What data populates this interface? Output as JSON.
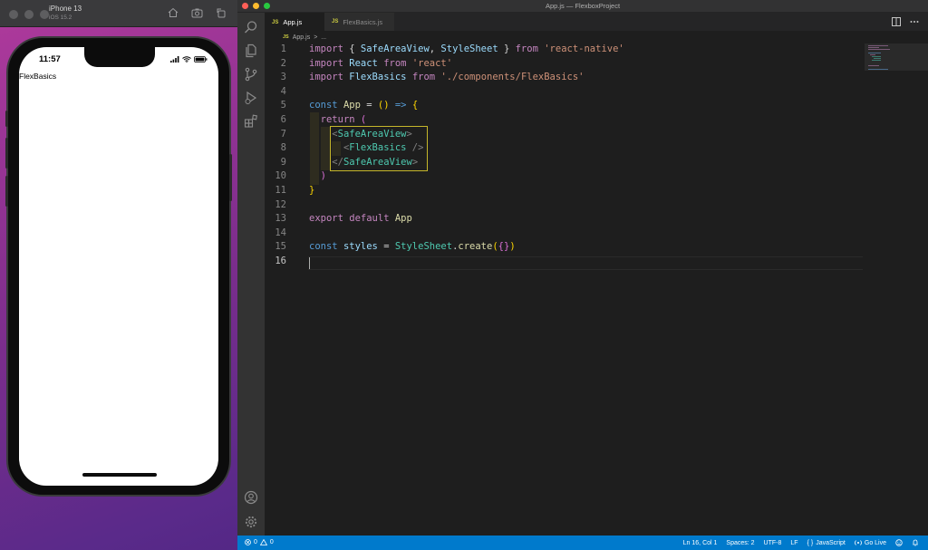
{
  "simulator": {
    "device_name": "iPhone 13",
    "os_version": "iOS 15.2",
    "status_time": "11:57",
    "app_text": "FlexBasics"
  },
  "vscode": {
    "window_title": "App.js — FlexboxProject",
    "tabs": [
      {
        "badge": "JS",
        "label": "App.js",
        "active": true
      },
      {
        "badge": "JS",
        "label": "FlexBasics.js",
        "active": false
      }
    ],
    "breadcrumb": {
      "badge": "JS",
      "file": "App.js",
      "separator": ">",
      "rest": "..."
    },
    "line_numbers": [
      "1",
      "2",
      "3",
      "4",
      "5",
      "6",
      "7",
      "8",
      "9",
      "10",
      "11",
      "12",
      "13",
      "14",
      "15",
      "16"
    ],
    "code": {
      "l1": {
        "kw": "import",
        "open": " { ",
        "a": "SafeAreaView",
        "comma": ", ",
        "b": "StyleSheet",
        "close": " } ",
        "from": "from",
        "sp": " ",
        "str": "'react-native'"
      },
      "l2": {
        "kw": "import",
        "sp": " ",
        "a": "React",
        "sp2": " ",
        "from": "from",
        "sp3": " ",
        "str": "'react'"
      },
      "l3": {
        "kw": "import",
        "sp": " ",
        "a": "FlexBasics",
        "sp2": " ",
        "from": "from",
        "sp3": " ",
        "str": "'./components/FlexBasics'"
      },
      "l5": {
        "kw": "const",
        "sp": " ",
        "name": "App",
        "eq": " = ",
        "paren": "()",
        "arrow": " => ",
        "brace": "{"
      },
      "l6": {
        "indent": "  ",
        "kw": "return",
        "sp": " ",
        "paren": "("
      },
      "l7": {
        "indent": "    ",
        "lt": "<",
        "tag": "SafeAreaView",
        "gt": ">"
      },
      "l8": {
        "indent": "      ",
        "lt": "<",
        "tag": "FlexBasics",
        "gt": " />"
      },
      "l9": {
        "indent": "    ",
        "lt": "</",
        "tag": "SafeAreaView",
        "gt": ">"
      },
      "l10": {
        "indent": "  ",
        "paren": ")"
      },
      "l11": {
        "brace": "}"
      },
      "l13": {
        "kw": "export",
        "sp": " ",
        "kw2": "default",
        "sp2": " ",
        "name": "App"
      },
      "l15": {
        "kw": "const",
        "sp": " ",
        "name": "styles",
        "eq": " = ",
        "cls": "StyleSheet",
        "dot": ".",
        "fn": "create",
        "open": "(",
        "brace": "{}",
        "close": ")"
      }
    },
    "statusbar": {
      "errors": "0",
      "warnings": "0",
      "position": "Ln 16, Col 1",
      "spaces": "Spaces: 2",
      "encoding": "UTF-8",
      "eol": "LF",
      "language_glyph": "{ }",
      "language": "JavaScript",
      "golive": "Go Live"
    }
  },
  "colors": {
    "editor_bg": "#1e1e1e",
    "statusbar": "#007acc",
    "keyword": "#c586c0",
    "string": "#ce9178",
    "type": "#4ec9b0"
  }
}
